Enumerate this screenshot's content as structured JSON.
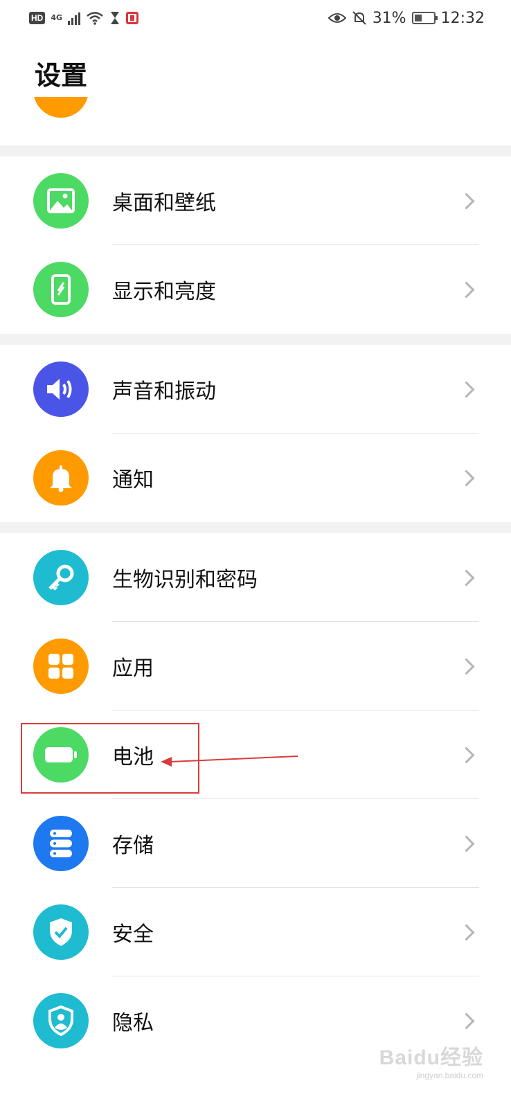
{
  "status_bar": {
    "left": {
      "hd": "HD",
      "network": "4G",
      "icons": [
        "signal-icon",
        "wifi-icon",
        "hourglass-icon",
        "red-app-icon"
      ]
    },
    "right": {
      "battery_percent": "31%",
      "time": "12:32",
      "icons": [
        "eye-icon",
        "bell-off-icon",
        "battery-icon"
      ]
    }
  },
  "header": {
    "title": "设置"
  },
  "groups": [
    {
      "items": [
        {
          "label": "桌面和壁纸",
          "icon": "wallpaper-icon",
          "color": "#4cd964"
        },
        {
          "label": "显示和亮度",
          "icon": "display-icon",
          "color": "#4cd964"
        }
      ]
    },
    {
      "items": [
        {
          "label": "声音和振动",
          "icon": "sound-icon",
          "color": "#4a55e8"
        },
        {
          "label": "通知",
          "icon": "bell-icon",
          "color": "#ff9b00"
        }
      ]
    },
    {
      "items": [
        {
          "label": "生物识别和密码",
          "icon": "key-icon",
          "color": "#1fbbd0"
        },
        {
          "label": "应用",
          "icon": "apps-icon",
          "color": "#ff9b00"
        },
        {
          "label": "电池",
          "icon": "battery-icon",
          "color": "#4cd964"
        },
        {
          "label": "存储",
          "icon": "storage-icon",
          "color": "#1e78f0"
        },
        {
          "label": "安全",
          "icon": "shield-check-icon",
          "color": "#1fbbd0"
        },
        {
          "label": "隐私",
          "icon": "privacy-icon",
          "color": "#1fbbd0"
        }
      ]
    }
  ],
  "watermark": {
    "text": "Baidu经验",
    "sub": "jingyan.baidu.com"
  },
  "colors": {
    "annotation": "#d93b3b",
    "divider": "#e2e2e2",
    "section_gap": "#f2f2f2"
  }
}
